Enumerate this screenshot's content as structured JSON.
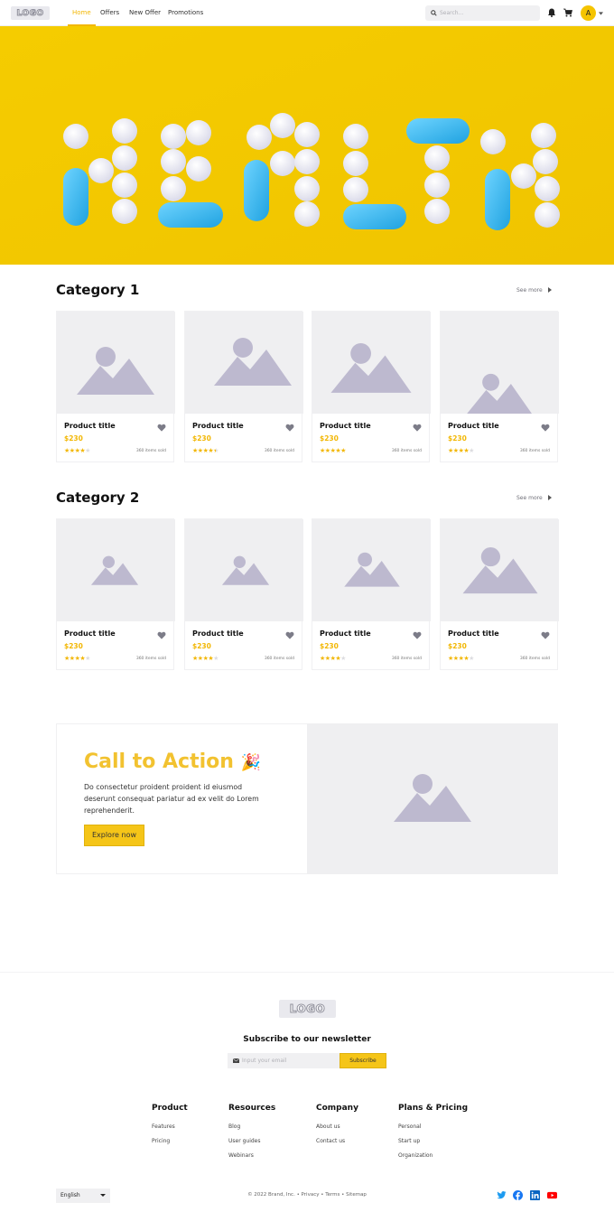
{
  "header": {
    "logo_text": "LOGO",
    "nav": [
      "Home",
      "Offers",
      "New Offer",
      "Promotions"
    ],
    "search_placeholder": "Search...",
    "avatar_initial": "A",
    "accent_color": "#f2b705"
  },
  "hero": {
    "image_text": "HEALTH",
    "background_color": "#f3c800"
  },
  "categories": [
    {
      "title": "Category 1",
      "see_more": "See more",
      "products": [
        {
          "title": "Product title",
          "price": "$230",
          "rating": 4,
          "sold": "360 items sold"
        },
        {
          "title": "Product title",
          "price": "$230",
          "rating": 4.5,
          "sold": "360 items sold"
        },
        {
          "title": "Product title",
          "price": "$230",
          "rating": 5,
          "sold": "360 items sold"
        },
        {
          "title": "Product title",
          "price": "$230",
          "rating": 4,
          "sold": "360 items sold"
        }
      ]
    },
    {
      "title": "Category 2",
      "see_more": "See more",
      "products": [
        {
          "title": "Product title",
          "price": "$230",
          "rating": 4,
          "sold": "360 items sold"
        },
        {
          "title": "Product title",
          "price": "$230",
          "rating": 4,
          "sold": "360 items sold"
        },
        {
          "title": "Product title",
          "price": "$230",
          "rating": 4,
          "sold": "360 items sold"
        },
        {
          "title": "Product title",
          "price": "$230",
          "rating": 4,
          "sold": "360 items sold"
        }
      ]
    }
  ],
  "cta": {
    "title": "Call to Action",
    "emoji": "🎉",
    "body": "Do consectetur proident proident id eiusmod deserunt consequat pariatur ad ex velit do Lorem reprehenderit.",
    "button": "Explore now"
  },
  "footer": {
    "logo_text": "LOGO",
    "newsletter_title": "Subscribe to our newsletter",
    "email_placeholder": "Input your email",
    "subscribe_button": "Subscribe",
    "columns": [
      {
        "title": "Product",
        "links": [
          "Features",
          "Pricing"
        ]
      },
      {
        "title": "Resources",
        "links": [
          "Blog",
          "User guides",
          "Webinars"
        ]
      },
      {
        "title": "Company",
        "links": [
          "About us",
          "Contact us"
        ]
      },
      {
        "title": "Plans & Pricing",
        "links": [
          "Personal",
          "Start up",
          "Organization"
        ]
      }
    ],
    "language": "English",
    "copyright": "© 2022 Brand, Inc. • Privacy • Terms • Sitemap",
    "social": [
      "twitter-icon",
      "facebook-icon",
      "linkedin-icon",
      "youtube-icon"
    ]
  }
}
